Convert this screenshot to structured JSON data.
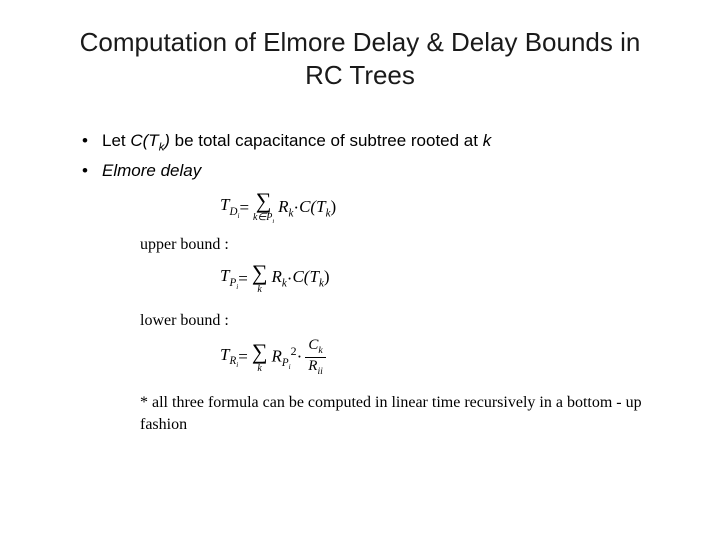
{
  "title": "Computation of Elmore Delay & Delay Bounds in RC Trees",
  "bullets": {
    "b1_pre": "Let ",
    "b1_sym": "C(T",
    "b1_sub": "k",
    "b1_post": ")",
    "b1_rest": " be total capacitance of subtree rooted at ",
    "b1_var": "k",
    "b2": "Elmore delay"
  },
  "labels": {
    "upper": "upper bound :",
    "lower": "lower bound :",
    "footnote": "* all three formula can be computed in linear time recursively in a bottom - up fashion"
  },
  "eq1": {
    "lhs_T": "T",
    "lhs_sub": "D",
    "lhs_subsub": "i",
    "eq": " = ",
    "sum_under": "k∈P",
    "sum_under_sub": "i",
    "R": "R",
    "R_sub": "k",
    "dot": " · ",
    "C": "C(T",
    "C_sub": "k",
    "C_close": ")"
  },
  "eq2": {
    "lhs_T": "T",
    "lhs_sub": "P",
    "lhs_subsub": "i",
    "eq": " = ",
    "sum_under": "k",
    "R": "R",
    "R_sub": "k",
    "dot": " · ",
    "C": "C(T",
    "C_sub": "k",
    "C_close": ")"
  },
  "eq3": {
    "lhs_T": "T",
    "lhs_sub": "R",
    "lhs_subsub": "i",
    "eq": " = ",
    "sum_under": "k",
    "R": "R",
    "R_sub": "P",
    "R_subsub": "i",
    "R_sup": "2",
    "dot": " · ",
    "frac_num": "C",
    "frac_num_sub": "k",
    "frac_den": "R",
    "frac_den_sub": "ii"
  }
}
